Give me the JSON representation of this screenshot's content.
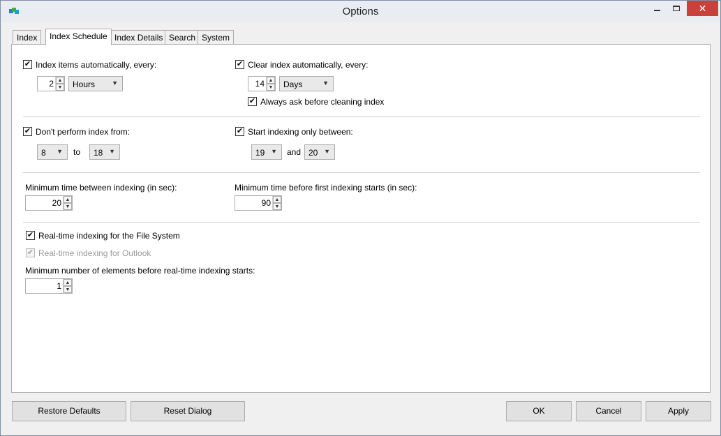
{
  "window": {
    "title": "Options",
    "close_glyph": "✕"
  },
  "tabs": [
    "Index",
    "Index Schedule",
    "Index Details",
    "Search",
    "System"
  ],
  "schedule": {
    "index_auto": {
      "checked": true,
      "label": "Index items automatically, every:",
      "value": "2",
      "unit": "Hours"
    },
    "clear_auto": {
      "checked": true,
      "label": "Clear index automatically, every:",
      "value": "14",
      "unit": "Days"
    },
    "always_ask": {
      "checked": true,
      "label": "Always ask before cleaning index"
    },
    "dont_perform": {
      "checked": true,
      "label": "Don't perform index from:",
      "from": "8",
      "to_label": "to",
      "to": "18"
    },
    "start_between": {
      "checked": true,
      "label": "Start indexing only between:",
      "from": "19",
      "and_label": "and",
      "to": "20"
    },
    "min_between": {
      "label": "Minimum time between indexing (in sec):",
      "value": "20"
    },
    "min_first": {
      "label": "Minimum time before first indexing starts (in sec):",
      "value": "90"
    },
    "realtime_fs": {
      "checked": true,
      "label": "Real-time indexing for the File System"
    },
    "realtime_outlook": {
      "checked": true,
      "disabled": true,
      "label": "Real-time indexing for Outlook"
    },
    "min_elements": {
      "label": "Minimum number of elements before real-time indexing starts:",
      "value": "1"
    }
  },
  "buttons": {
    "restore": "Restore Defaults",
    "reset": "Reset Dialog",
    "ok": "OK",
    "cancel": "Cancel",
    "apply": "Apply"
  },
  "glyphs": {
    "check": "✔",
    "up": "▲",
    "down": "▼",
    "caret": "▼"
  },
  "icons": [
    "app-icon",
    "minimize-icon",
    "maximize-icon",
    "close-icon"
  ]
}
